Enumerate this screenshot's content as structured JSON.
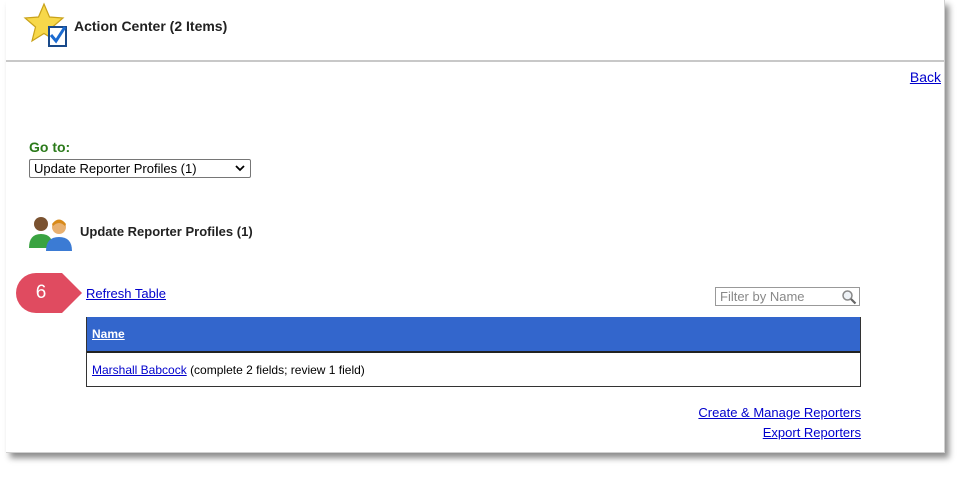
{
  "header": {
    "title": "Action Center (2 Items)",
    "icon": "star-check-icon"
  },
  "nav": {
    "back_label": "Back"
  },
  "goto": {
    "label": "Go to:",
    "selected": "Update Reporter Profiles (1)"
  },
  "section": {
    "title": "Update Reporter Profiles (1)",
    "icon": "people-icon"
  },
  "callout": {
    "step": "6",
    "color": "#e04b60"
  },
  "table": {
    "refresh_label": "Refresh Table",
    "filter_placeholder": "Filter by Name",
    "header_color": "#3366cc",
    "columns": [
      "Name"
    ],
    "rows": [
      {
        "name": "Marshall Babcock",
        "detail": "(complete 2 fields; review 1 field)"
      }
    ]
  },
  "footer": {
    "links": [
      "Create & Manage Reporters",
      "Export Reporters"
    ]
  }
}
